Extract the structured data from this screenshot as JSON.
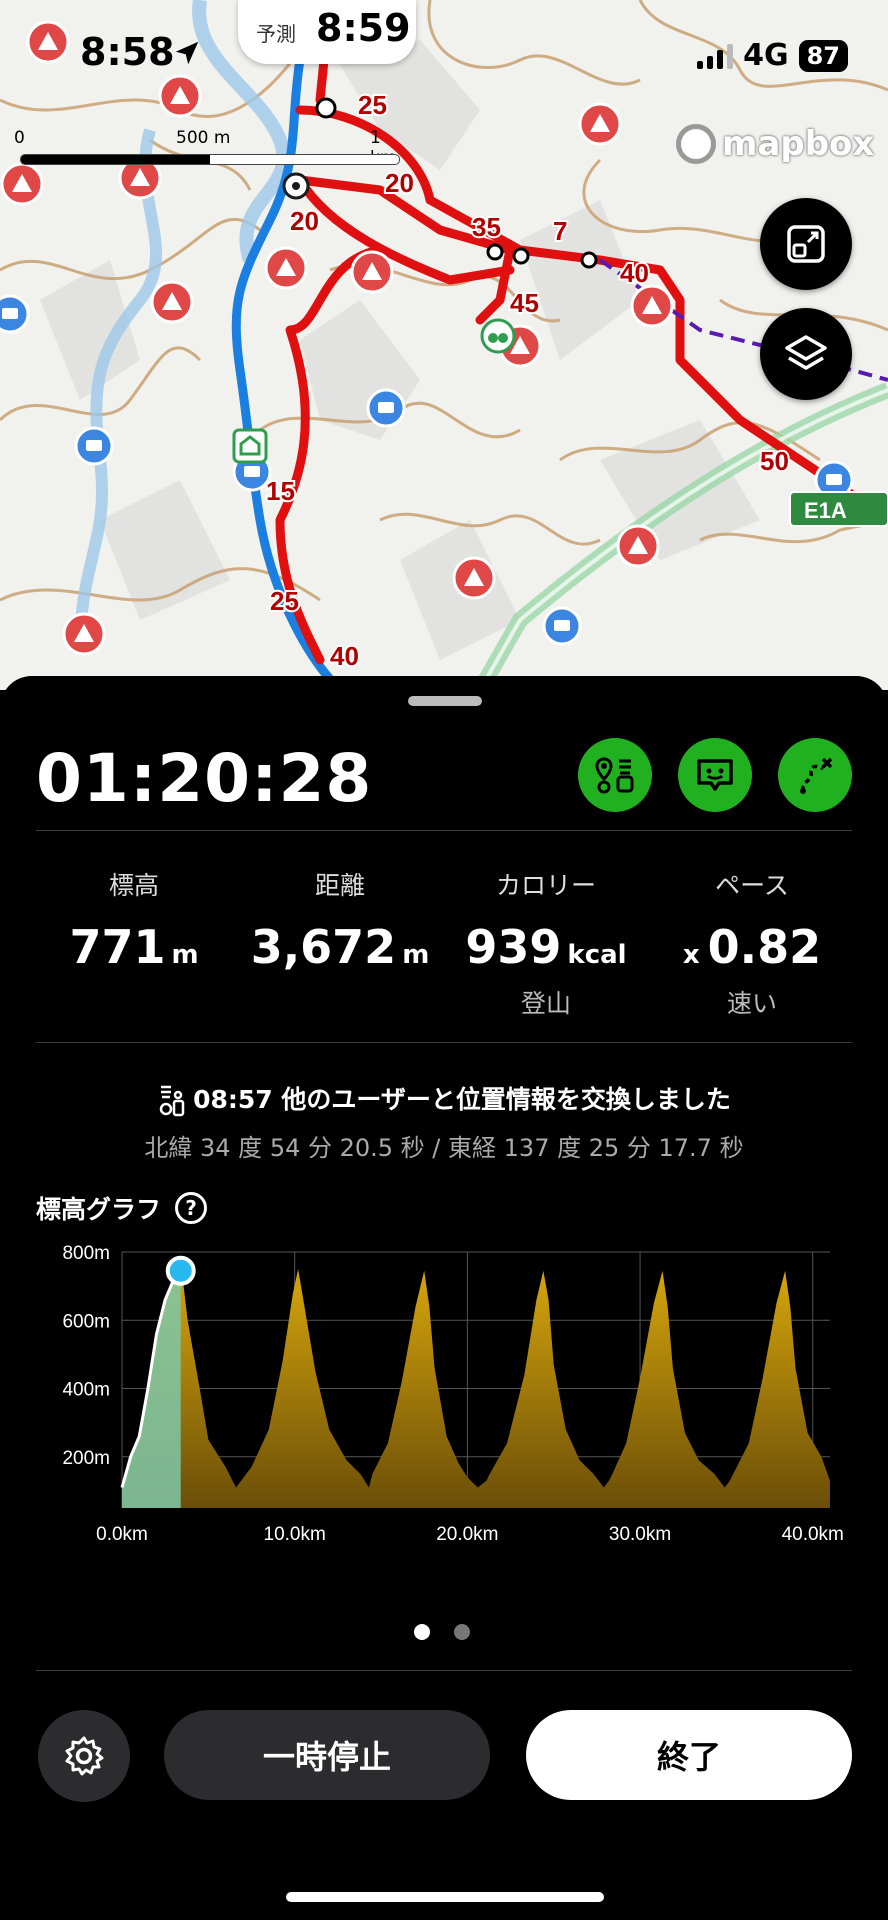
{
  "status": {
    "time": "8:58",
    "network": "4G",
    "battery": "87"
  },
  "prediction": {
    "label": "予測",
    "time": "8:59"
  },
  "map": {
    "scale_labels": [
      "0",
      "500 m",
      "1 km"
    ],
    "attribution": "mapbox",
    "route_markers": [
      "25",
      "20",
      "35",
      "7",
      "40",
      "45",
      "20",
      "15",
      "25",
      "40",
      "50"
    ],
    "road_sign": "E1A"
  },
  "tracking": {
    "elapsed": "01:20:28",
    "actions": [
      "share-location-icon",
      "report-icon",
      "route-icon"
    ]
  },
  "stats": [
    {
      "label": "標高",
      "value": "771",
      "unit": "m",
      "sub": ""
    },
    {
      "label": "距離",
      "value": "3,672",
      "unit": "m",
      "sub": ""
    },
    {
      "label": "カロリー",
      "value": "939",
      "unit": "kcal",
      "sub": "登山"
    },
    {
      "label": "ペース",
      "prefix": "x",
      "value": "0.82",
      "unit": "",
      "sub": "速い"
    }
  ],
  "event": {
    "text": "08:57 他のユーザーと位置情報を交換しました",
    "coords": "北緯 34 度 54 分 20.5 秒 / 東経 137 度 25 分 17.7 秒"
  },
  "graph": {
    "title": "標高グラフ",
    "help": "?"
  },
  "chart_data": {
    "type": "area",
    "title": "標高グラフ",
    "xlabel": "",
    "ylabel": "",
    "x_ticks": [
      "0.0km",
      "10.0km",
      "20.0km",
      "30.0km",
      "40.0km"
    ],
    "y_ticks": [
      "200m",
      "400m",
      "600m",
      "800m"
    ],
    "xlim": [
      0,
      41
    ],
    "ylim": [
      50,
      800
    ],
    "grid": true,
    "current_position": {
      "x": 3.4,
      "y": 745
    },
    "series": [
      {
        "x": [
          0,
          0.5,
          1,
          1.5,
          2,
          2.5,
          3,
          3.4,
          3.8,
          4.5,
          5,
          5.5,
          6,
          6.6,
          7.5,
          8.5,
          9.3,
          9.9,
          10.2,
          10.5,
          11.2,
          12,
          13,
          13.8,
          14.3,
          14.5,
          15.4,
          16.2,
          17,
          17.5,
          17.8,
          18.1,
          18.8,
          19.5,
          20,
          20.6,
          21.1,
          21.3,
          22.3,
          23.3,
          24,
          24.4,
          24.7,
          25,
          25.7,
          26.5,
          27.3,
          27.9,
          28.2,
          28.4,
          29.2,
          30,
          30.8,
          31.3,
          31.6,
          31.9,
          32.6,
          33.4,
          34.3,
          34.9,
          35.2,
          35.4,
          36.3,
          37.1,
          37.9,
          38.4,
          38.7,
          39,
          39.7,
          40.5,
          41
        ],
        "y": [
          110,
          200,
          260,
          400,
          560,
          660,
          720,
          771,
          600,
          400,
          250,
          210,
          170,
          110,
          170,
          280,
          480,
          680,
          750,
          660,
          450,
          280,
          190,
          150,
          110,
          150,
          240,
          420,
          640,
          745,
          640,
          460,
          260,
          180,
          140,
          110,
          130,
          150,
          240,
          440,
          660,
          745,
          660,
          470,
          280,
          190,
          150,
          110,
          130,
          150,
          240,
          430,
          650,
          745,
          640,
          460,
          270,
          190,
          150,
          110,
          130,
          150,
          240,
          430,
          650,
          745,
          640,
          460,
          270,
          200,
          130
        ]
      }
    ]
  },
  "pager": {
    "count": 2,
    "active": 0
  },
  "controls": {
    "pause": "一時停止",
    "finish": "終了"
  },
  "colors": {
    "route": "#e01010",
    "track": "#1a7fe0",
    "accent": "#20b020",
    "profile": "#d9a80c",
    "progress": "#7fc8a8",
    "marker": "#28b8f0"
  }
}
